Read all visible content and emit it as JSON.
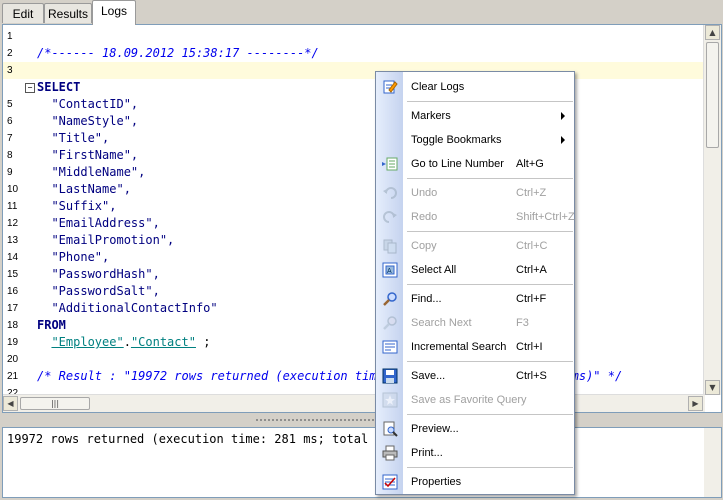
{
  "tabs": [
    {
      "label": "Edit",
      "active": false
    },
    {
      "label": "Results",
      "active": false
    },
    {
      "label": "Logs",
      "active": true
    }
  ],
  "editor": {
    "lines": [
      {
        "n": "1",
        "text": "",
        "cls": ""
      },
      {
        "n": "2",
        "text": "/*------ 18.09.2012 15:38:17 --------*/",
        "cls": "c-comment"
      },
      {
        "n": "3",
        "text": "",
        "cls": "",
        "highlight": true
      },
      {
        "n": "",
        "text": "SELECT",
        "cls": "c-kw",
        "fold": true
      },
      {
        "n": "5",
        "text": "  \"ContactID\",",
        "cls": "c-str"
      },
      {
        "n": "6",
        "text": "  \"NameStyle\",",
        "cls": "c-str"
      },
      {
        "n": "7",
        "text": "  \"Title\",",
        "cls": "c-str"
      },
      {
        "n": "8",
        "text": "  \"FirstName\",",
        "cls": "c-str"
      },
      {
        "n": "9",
        "text": "  \"MiddleName\",",
        "cls": "c-str"
      },
      {
        "n": "10",
        "text": "  \"LastName\",",
        "cls": "c-str"
      },
      {
        "n": "11",
        "text": "  \"Suffix\",",
        "cls": "c-str"
      },
      {
        "n": "12",
        "text": "  \"EmailAddress\",",
        "cls": "c-str"
      },
      {
        "n": "13",
        "text": "  \"EmailPromotion\",",
        "cls": "c-str"
      },
      {
        "n": "14",
        "text": "  \"Phone\",",
        "cls": "c-str"
      },
      {
        "n": "15",
        "text": "  \"PasswordHash\",",
        "cls": "c-str"
      },
      {
        "n": "16",
        "text": "  \"PasswordSalt\",",
        "cls": "c-str"
      },
      {
        "n": "17",
        "text": "  \"AdditionalContactInfo\"",
        "cls": "c-str"
      },
      {
        "n": "18",
        "text": "FROM",
        "cls": "c-kw"
      },
      {
        "n": "19",
        "text": "",
        "cls": "",
        "from_line": true
      },
      {
        "n": "20",
        "text": "",
        "cls": ""
      },
      {
        "n": "21",
        "text": "/* Result : \"19972 rows returned (execution time: 281 ms; total time: 546 ms)\" */",
        "cls": "c-comment"
      },
      {
        "n": "22",
        "text": "",
        "cls": ""
      }
    ],
    "from_table": {
      "schema": "\"Employee\"",
      "dot": ".",
      "table": "\"Contact\"",
      "suffix": " ;"
    }
  },
  "results": {
    "text": "19972 rows returned (execution time: 281 ms; total time: 546 ms)"
  },
  "context_menu": {
    "items": [
      {
        "label": "Clear Logs",
        "shortcut": "",
        "icon": "clear-logs-icon",
        "disabled": false,
        "submenu": false
      },
      {
        "sep": true
      },
      {
        "label": "Markers",
        "shortcut": "",
        "icon": "",
        "disabled": false,
        "submenu": true
      },
      {
        "label": "Toggle Bookmarks",
        "shortcut": "",
        "icon": "",
        "disabled": false,
        "submenu": true
      },
      {
        "label": "Go to Line Number",
        "shortcut": "Alt+G",
        "icon": "goto-line-icon",
        "disabled": false,
        "submenu": false
      },
      {
        "sep": true
      },
      {
        "label": "Undo",
        "shortcut": "Ctrl+Z",
        "icon": "undo-icon",
        "disabled": true,
        "submenu": false
      },
      {
        "label": "Redo",
        "shortcut": "Shift+Ctrl+Z",
        "icon": "redo-icon",
        "disabled": true,
        "submenu": false
      },
      {
        "sep": true
      },
      {
        "label": "Copy",
        "shortcut": "Ctrl+C",
        "icon": "copy-icon",
        "disabled": true,
        "submenu": false
      },
      {
        "label": "Select All",
        "shortcut": "Ctrl+A",
        "icon": "select-all-icon",
        "disabled": false,
        "submenu": false
      },
      {
        "sep": true
      },
      {
        "label": "Find...",
        "shortcut": "Ctrl+F",
        "icon": "find-icon",
        "disabled": false,
        "submenu": false
      },
      {
        "label": "Search Next",
        "shortcut": "F3",
        "icon": "search-next-icon",
        "disabled": true,
        "submenu": false
      },
      {
        "label": "Incremental Search",
        "shortcut": "Ctrl+I",
        "icon": "incremental-search-icon",
        "disabled": false,
        "submenu": false
      },
      {
        "sep": true
      },
      {
        "label": "Save...",
        "shortcut": "Ctrl+S",
        "icon": "save-icon",
        "disabled": false,
        "submenu": false
      },
      {
        "label": "Save as Favorite Query",
        "shortcut": "",
        "icon": "favorite-query-icon",
        "disabled": true,
        "submenu": false
      },
      {
        "sep": true
      },
      {
        "label": "Preview...",
        "shortcut": "",
        "icon": "preview-icon",
        "disabled": false,
        "submenu": false
      },
      {
        "label": "Print...",
        "shortcut": "",
        "icon": "print-icon",
        "disabled": false,
        "submenu": false
      },
      {
        "sep": true
      },
      {
        "label": "Properties",
        "shortcut": "",
        "icon": "properties-icon",
        "disabled": false,
        "submenu": false
      }
    ]
  },
  "colors": {
    "comment": "#0000ee",
    "keyword": "#000080",
    "identifier": "#008080",
    "current_line": "#fffbdc"
  }
}
